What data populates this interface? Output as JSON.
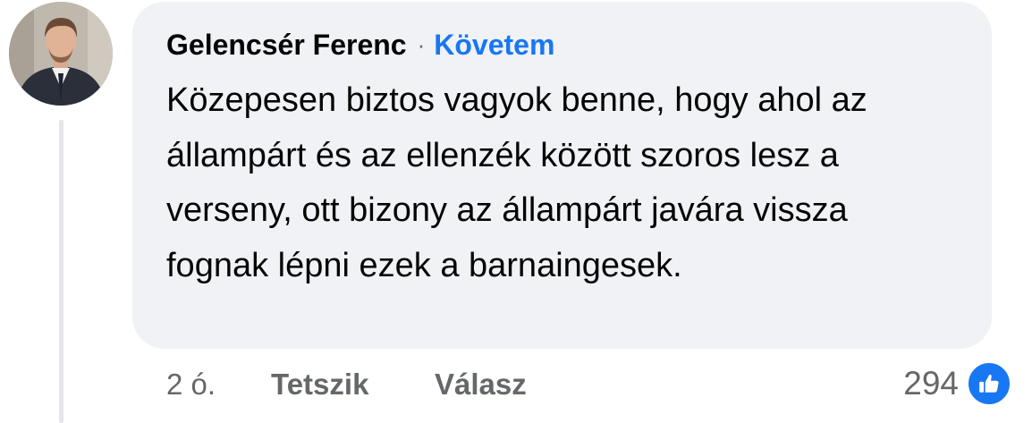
{
  "comment": {
    "author": "Gelencsér Ferenc",
    "separator": "·",
    "follow_label": "Követem",
    "text": "Közepesen biztos vagyok benne, hogy ahol az állampárt és az ellenzék között szoros lesz a verseny, ott bizony az állampárt javára vissza fognak lépni ezek a barnaingesek.",
    "timestamp": "2 ó.",
    "like_label": "Tetszik",
    "reply_label": "Válasz",
    "reaction_count": "294",
    "reaction_icon": "thumbs-up-icon"
  },
  "colors": {
    "bubble_bg": "#f0f2f5",
    "link_blue": "#1877f2",
    "secondary_text": "#65676b",
    "primary_text": "#050505"
  }
}
